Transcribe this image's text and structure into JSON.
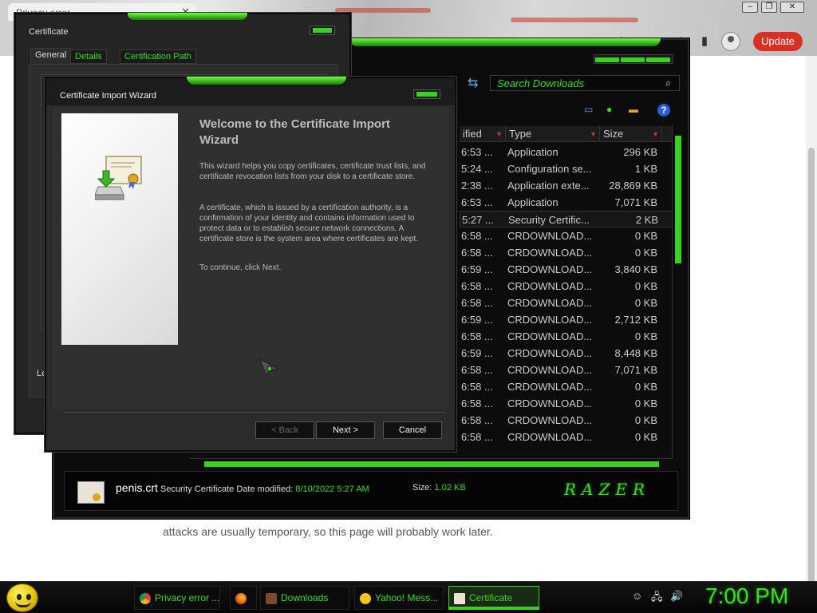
{
  "browser": {
    "tab_title": "Privacy error",
    "update_label": "Update",
    "page_text": "attacks are usually temporary, so this page will probably work later."
  },
  "downloads": {
    "search_placeholder": "Search Downloads",
    "columns": [
      "ified",
      "Type",
      "Size"
    ],
    "rows": [
      {
        "date": "6:53 ...",
        "type": "Application",
        "size": "296 KB"
      },
      {
        "date": "5:24 ...",
        "type": "Configuration se...",
        "size": "1 KB"
      },
      {
        "date": "2:38 ...",
        "type": "Application exte...",
        "size": "28,869 KB"
      },
      {
        "date": "6:53 ...",
        "type": "Application",
        "size": "7,071 KB"
      },
      {
        "date": "5:27 ...",
        "type": "Security Certific...",
        "size": "2 KB"
      },
      {
        "date": "6:58 ...",
        "type": "CRDOWNLOAD...",
        "size": "0 KB"
      },
      {
        "date": "6:58 ...",
        "type": "CRDOWNLOAD...",
        "size": "0 KB"
      },
      {
        "date": "6:59 ...",
        "type": "CRDOWNLOAD...",
        "size": "3,840 KB"
      },
      {
        "date": "6:58 ...",
        "type": "CRDOWNLOAD...",
        "size": "0 KB"
      },
      {
        "date": "6:58 ...",
        "type": "CRDOWNLOAD...",
        "size": "0 KB"
      },
      {
        "date": "6:59 ...",
        "type": "CRDOWNLOAD...",
        "size": "2,712 KB"
      },
      {
        "date": "6:58 ...",
        "type": "CRDOWNLOAD...",
        "size": "0 KB"
      },
      {
        "date": "6:59 ...",
        "type": "CRDOWNLOAD...",
        "size": "8,448 KB"
      },
      {
        "date": "6:58 ...",
        "type": "CRDOWNLOAD...",
        "size": "7,071 KB"
      },
      {
        "date": "6:58 ...",
        "type": "CRDOWNLOAD...",
        "size": "0 KB"
      },
      {
        "date": "6:58 ...",
        "type": "CRDOWNLOAD...",
        "size": "0 KB"
      },
      {
        "date": "6:58 ...",
        "type": "CRDOWNLOAD...",
        "size": "0 KB"
      },
      {
        "date": "6:58 ...",
        "type": "CRDOWNLOAD...",
        "size": "0 KB"
      }
    ],
    "details": {
      "file_name": "penis.crt",
      "file_type": "Security Certificate",
      "date_label": "Date modified:",
      "date_value": "8/10/2022 5:27 AM",
      "size_label": "Size:",
      "size_value": "1.02 KB",
      "logo": "RAZER"
    }
  },
  "cert_dialog": {
    "title": "Certificate",
    "tabs": [
      "General",
      "Details",
      "Certification Path"
    ],
    "partial_label": "Le"
  },
  "wizard": {
    "title": "Certificate Import Wizard",
    "heading": "Welcome to the Certificate Import Wizard",
    "para1": "This wizard helps you copy certificates, certificate trust lists, and certificate revocation lists from your disk to a certificate store.",
    "para2": "A certificate, which is issued by a certification authority, is a confirmation of your identity and contains information used to protect data or to establish secure network connections. A certificate store is the system area where certificates are kept.",
    "para3": "To continue, click Next.",
    "back_label": "< Back",
    "next_label": "Next >",
    "cancel_label": "Cancel"
  },
  "taskbar": {
    "items": [
      {
        "label": "Privacy error ...",
        "icon": "chrome-icon"
      },
      {
        "label": "",
        "icon": "firefox-icon"
      },
      {
        "label": "Downloads",
        "icon": "downloads-icon"
      },
      {
        "label": "Yahoo! Mess...",
        "icon": "yahoo-messenger-icon"
      },
      {
        "label": "Certificate",
        "icon": "certificate-icon"
      }
    ],
    "clock": "7:00 PM"
  },
  "colors": {
    "accent_green": "#3ddc27",
    "update_red": "#d93025"
  }
}
